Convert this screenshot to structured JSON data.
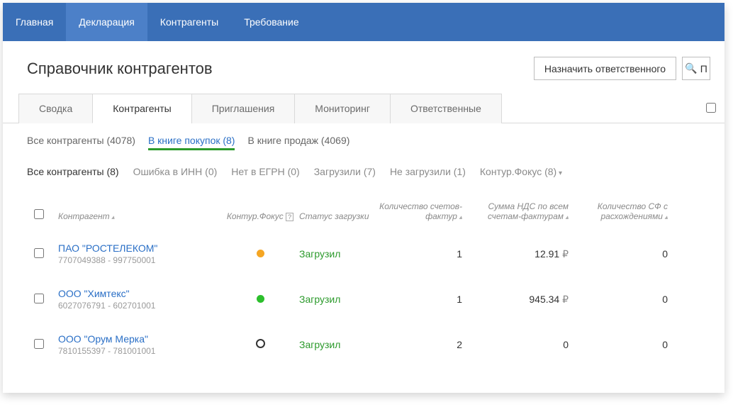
{
  "topnav": {
    "items": [
      "Главная",
      "Декларация",
      "Контрагенты",
      "Требование"
    ],
    "active_index": 1
  },
  "header": {
    "title": "Справочник контрагентов",
    "assign_button": "Назначить ответственного",
    "search_placeholder": "П"
  },
  "tabs": {
    "items": [
      "Сводка",
      "Контрагенты",
      "Приглашения",
      "Мониторинг",
      "Ответственные"
    ],
    "active_index": 1
  },
  "subtabs": {
    "items": [
      {
        "label": "Все контрагенты (4078)"
      },
      {
        "label": "В книге покупок (8)",
        "active": true
      },
      {
        "label": "В книге продаж (4069)"
      }
    ]
  },
  "filters": {
    "items": [
      {
        "label": "Все контрагенты (8)",
        "active": true
      },
      {
        "label": "Ошибка в ИНН (0)"
      },
      {
        "label": "Нет в ЕГРН (0)"
      },
      {
        "label": "Загрузили (7)"
      },
      {
        "label": "Не загрузили (1)"
      },
      {
        "label": "Контур.Фокус (8)",
        "dropdown": true
      }
    ]
  },
  "columns": {
    "name": "Контрагент",
    "focus": "Контур.Фокус",
    "status": "Статус загрузки",
    "count": "Количество счетов-фактур",
    "sum": "Сумма НДС по всем счетам-фактурам",
    "diff": "Количество СФ с расхождениями"
  },
  "rows": [
    {
      "name": "ПАО \"РОСТЕЛЕКОМ\"",
      "ids": "7707049388 - 997750001",
      "focus_color": "orange",
      "status": "Загрузил",
      "count": "1",
      "sum": "12.91",
      "diff": "0"
    },
    {
      "name": "ООО \"Химтекс\"",
      "ids": "6027076791 - 602701001",
      "focus_color": "green",
      "status": "Загрузил",
      "count": "1",
      "sum": "945.34",
      "diff": "0"
    },
    {
      "name": "ООО \"Орум Мерка\"",
      "ids": "7810155397 - 781001001",
      "focus_color": "ring",
      "status": "Загрузил",
      "count": "2",
      "sum": "0",
      "diff": "0"
    }
  ]
}
